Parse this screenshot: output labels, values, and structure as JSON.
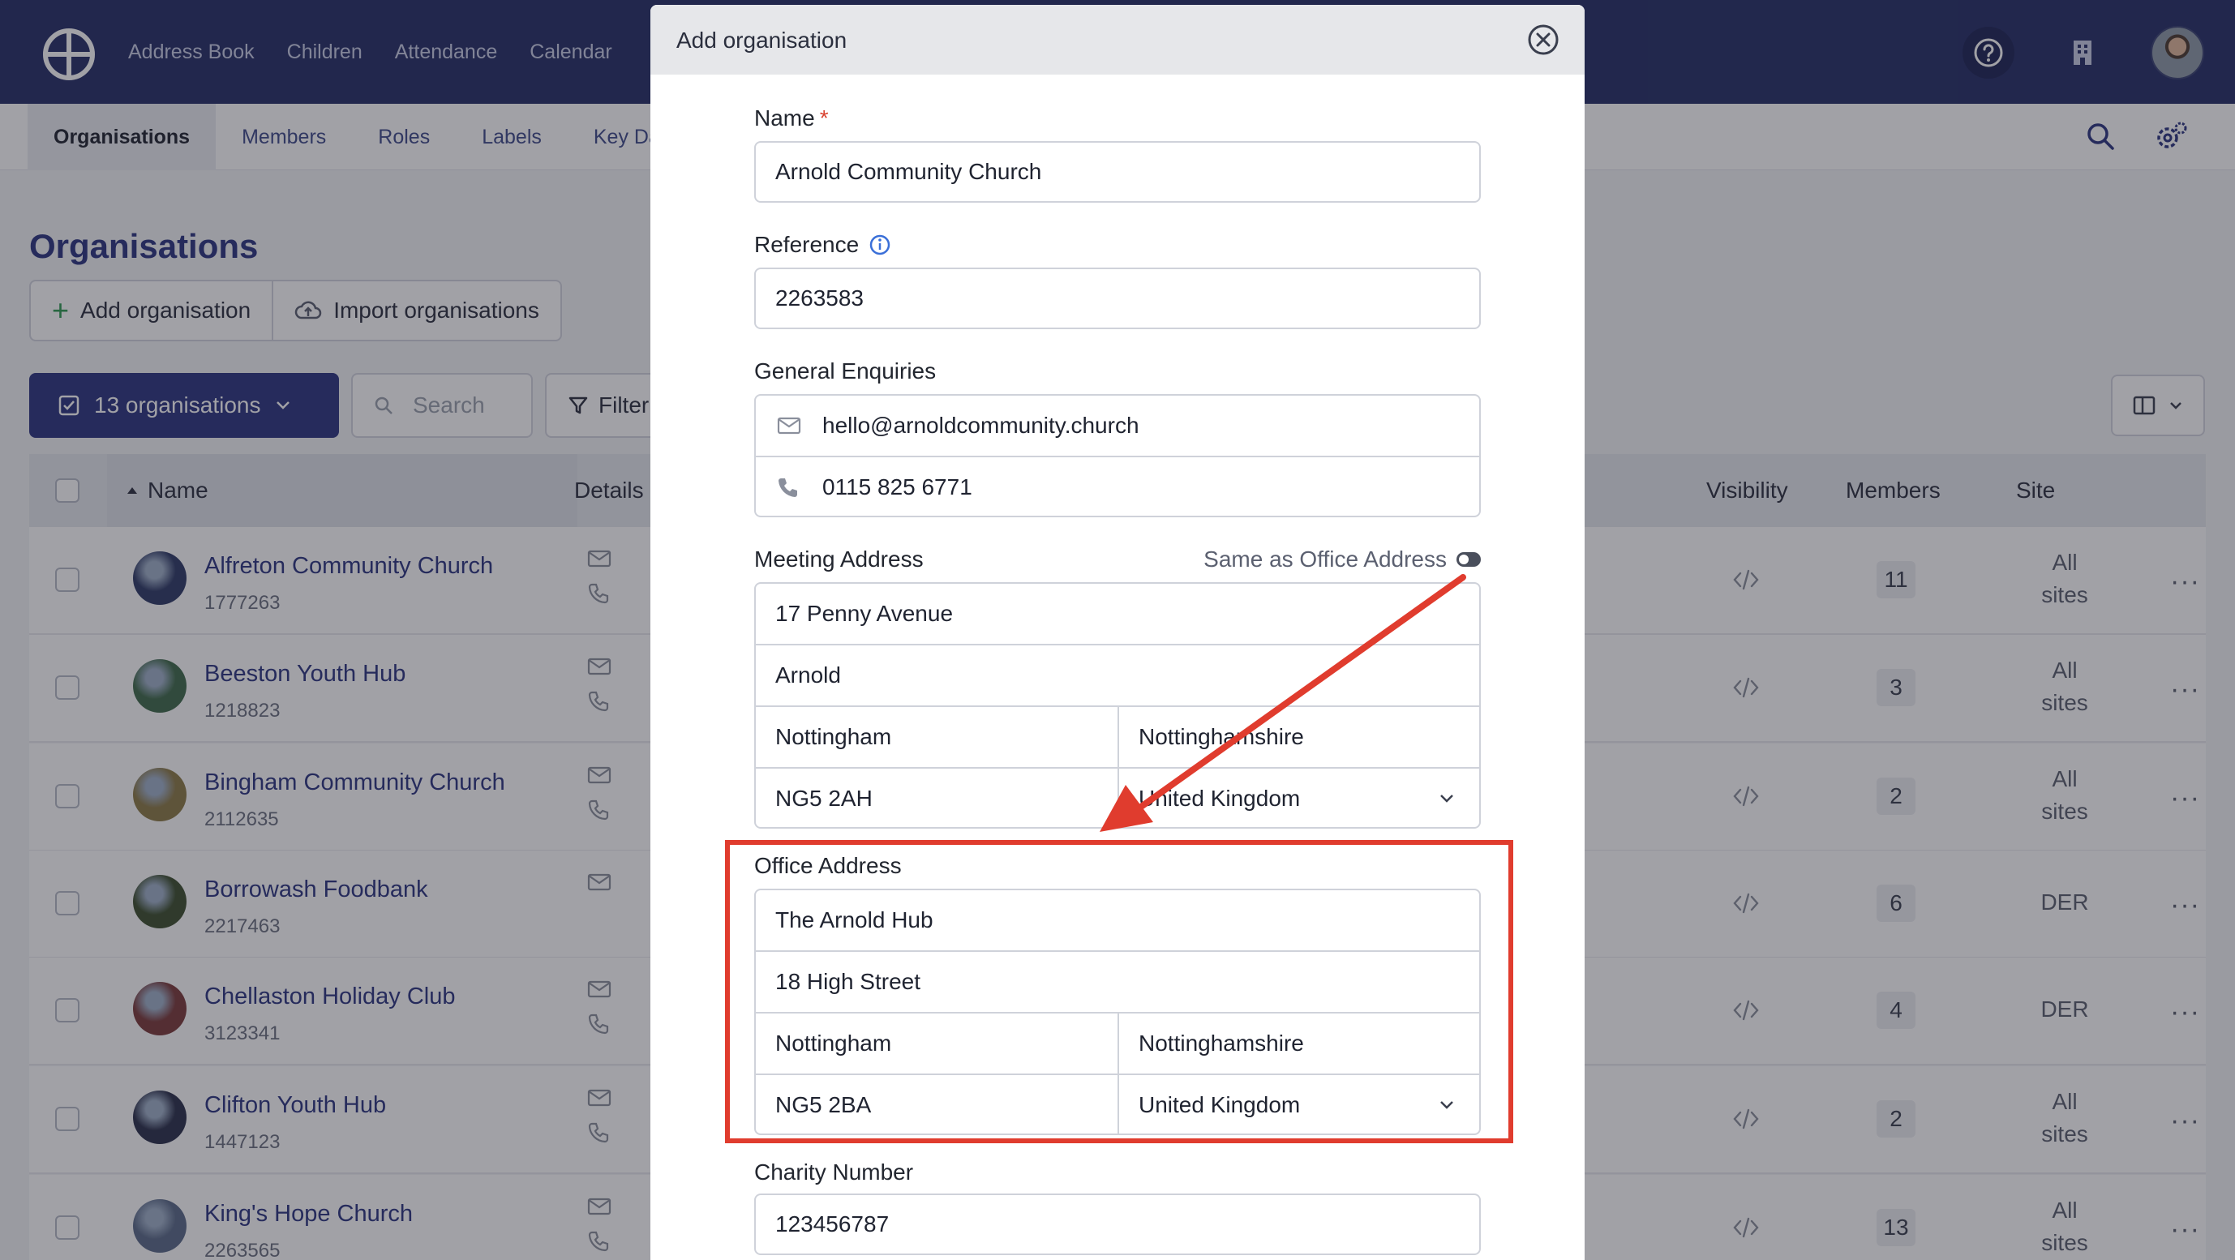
{
  "nav": {
    "links": [
      "Address Book",
      "Children",
      "Attendance",
      "Calendar"
    ],
    "icons": [
      "help-icon",
      "building-icon"
    ]
  },
  "subnav": {
    "tabs": [
      "Organisations",
      "Members",
      "Roles",
      "Labels",
      "Key Da"
    ]
  },
  "page": {
    "title": "Organisations",
    "add_label": "Add organisation",
    "import_label": "Import organisations",
    "count_label": "13 organisations",
    "search_placeholder": "Search",
    "filter_label": "Filter"
  },
  "table": {
    "headers": {
      "name": "Name",
      "details": "Details",
      "visibility": "Visibility",
      "members": "Members",
      "site": "Site"
    },
    "rows": [
      {
        "name": "Alfreton Community Church",
        "ref": "1777263",
        "members": "11",
        "site": "All sites",
        "phone": true,
        "avatar_color": "#2e3a66"
      },
      {
        "name": "Beeston Youth Hub",
        "ref": "1218823",
        "members": "3",
        "site": "All sites",
        "phone": true,
        "avatar_color": "#3f6a4a"
      },
      {
        "name": "Bingham Community Church",
        "ref": "2112635",
        "members": "2",
        "site": "All sites",
        "phone": true,
        "avatar_color": "#8c7a46"
      },
      {
        "name": "Borrowash Foodbank",
        "ref": "2217463",
        "members": "6",
        "site": "DER",
        "phone": false,
        "avatar_color": "#3d4f2e"
      },
      {
        "name": "Chellaston Holiday Club",
        "ref": "3123341",
        "members": "4",
        "site": "DER",
        "phone": true,
        "avatar_color": "#7a3a3a"
      },
      {
        "name": "Clifton Youth Hub",
        "ref": "1447123",
        "members": "2",
        "site": "All sites",
        "phone": true,
        "avatar_color": "#2a2f4a"
      },
      {
        "name": "King's Hope Church",
        "ref": "2263565",
        "members": "13",
        "site": "All sites",
        "phone": true,
        "avatar_color": "#5a6a88"
      }
    ]
  },
  "modal": {
    "title": "Add organisation",
    "name_label": "Name",
    "required_mark": "*",
    "name_value": "Arnold Community Church",
    "reference_label": "Reference",
    "reference_value": "2263583",
    "enquiries_label": "General Enquiries",
    "email_value": "hello@arnoldcommunity.church",
    "phone_value": "0115 825 6771",
    "meeting_label": "Meeting Address",
    "same_as_label": "Same as Office Address",
    "meeting": {
      "line1": "17 Penny Avenue",
      "line2": "Arnold",
      "city": "Nottingham",
      "county": "Nottinghamshire",
      "postcode": "NG5 2AH",
      "country": "United Kingdom"
    },
    "office_label": "Office Address",
    "office": {
      "line1": "The Arnold Hub",
      "line2": "18 High Street",
      "city": "Nottingham",
      "county": "Nottinghamshire",
      "postcode": "NG5 2BA",
      "country": "United Kingdom"
    },
    "charity_label": "Charity Number",
    "charity_value": "123456787"
  },
  "colors": {
    "brand": "#252d66",
    "accent": "#2b3580",
    "annotation": "#e03c2e"
  }
}
